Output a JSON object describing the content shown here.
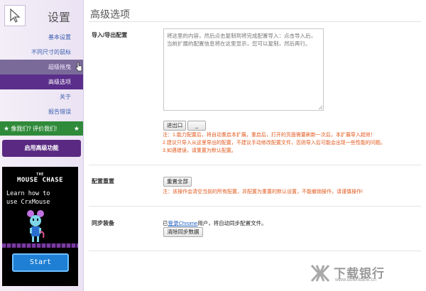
{
  "sidebar": {
    "title": "设置",
    "items": [
      {
        "label": "基本设置"
      },
      {
        "label": "不同尺寸的鼠标"
      },
      {
        "label": "超级拖曳"
      },
      {
        "label": "高级选项"
      },
      {
        "label": "关于"
      },
      {
        "label": "报告错误"
      }
    ],
    "rate_label": "像我们? 评价我们!",
    "pro_button": "启用高级功能"
  },
  "ad": {
    "title_the": "THE",
    "title": "MOUSE CHASE",
    "line1": "Learn how to",
    "line2": "use CrxMouse",
    "start_button": "Start"
  },
  "main": {
    "title": "高级选项",
    "import_export": {
      "label": "导入/导出配置",
      "placeholder": "将这里的内容，然后点击复制到将完成配置导入：点击导入后，当前扩展的配置信息将在这里显示，您可以复制，然后再行。",
      "import_button": "进出口",
      "export_button": "_",
      "warnings": [
        "注：1.能力配置后，将自动重启本扩展，重启后，打开的页面需要刷新一次后，本扩展导入超效！",
        "2.建议只导入从这里导出的配置，不建议手动修改配置文件，否则导入后可能会出现一些性能的问题。",
        "3.如遇错误，请重置为默认配置。"
      ]
    },
    "reset": {
      "label": "配置重置",
      "button": "重置全部",
      "warning": "注：该操作会清空当前的所有配置，并配置为重置的默认设置，不能撤销操作，请谨慎操作!"
    },
    "sync": {
      "label": "同步装备",
      "text_before": "已",
      "link": "登录Chrome",
      "text_after": "用户，将自动同步配置文件。",
      "button": "清除同步数据"
    }
  },
  "watermark": {
    "text": "下载银行",
    "url": "www.downbank.cn"
  }
}
